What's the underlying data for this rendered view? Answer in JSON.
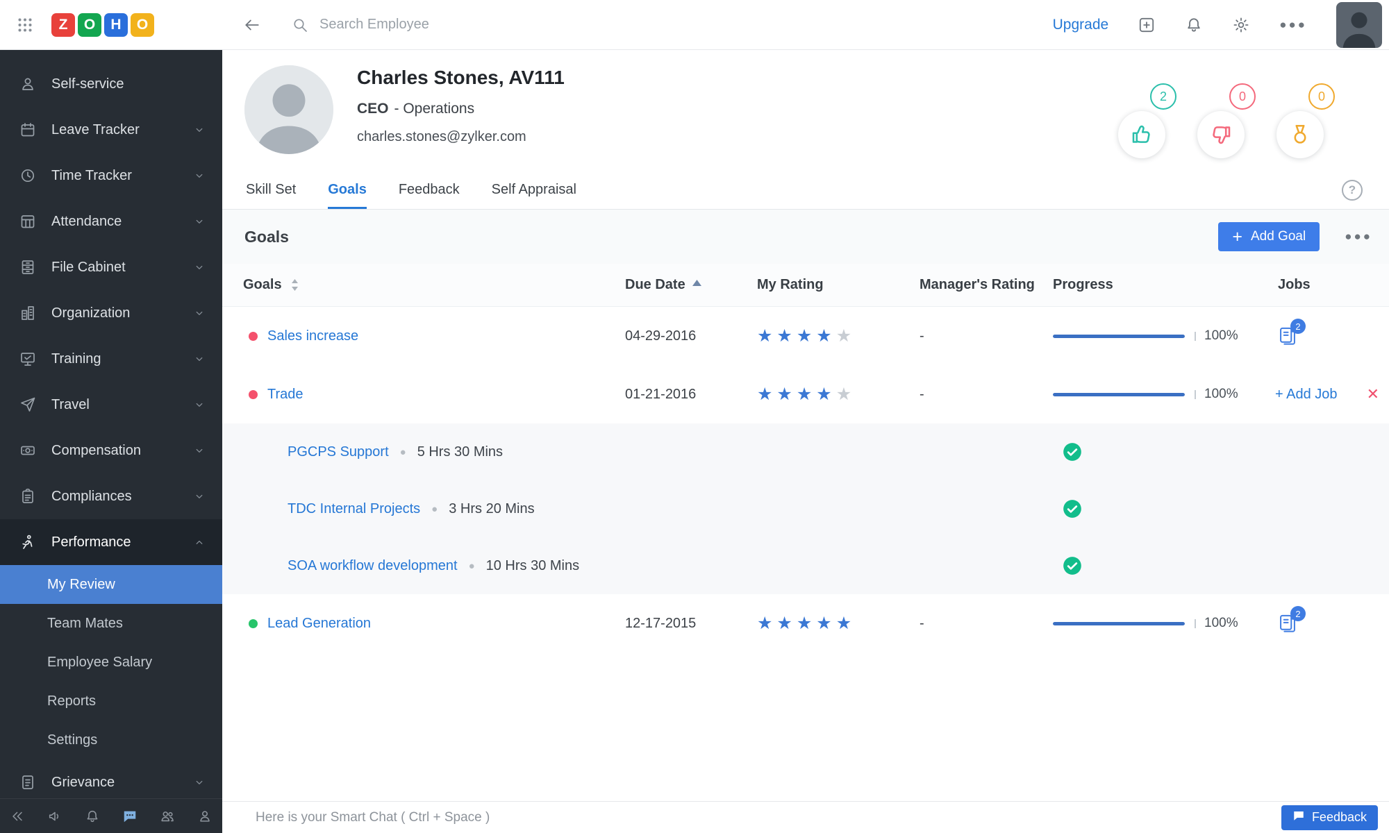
{
  "topbar": {
    "logo_letters": [
      "Z",
      "O",
      "H",
      "O"
    ],
    "logo_colors": [
      "#e8413b",
      "#13a650",
      "#2a6fdb",
      "#f2b21c"
    ],
    "search_placeholder": "Search Employee",
    "upgrade_label": "Upgrade"
  },
  "sidebar": {
    "items": [
      {
        "label": "Self-service",
        "icon": "user-icon",
        "chevron": false
      },
      {
        "label": "Leave Tracker",
        "icon": "calendar-icon",
        "chevron": true
      },
      {
        "label": "Time Tracker",
        "icon": "clock-icon",
        "chevron": true
      },
      {
        "label": "Attendance",
        "icon": "calendar-grid-icon",
        "chevron": true
      },
      {
        "label": "File Cabinet",
        "icon": "cabinet-icon",
        "chevron": true
      },
      {
        "label": "Organization",
        "icon": "building-icon",
        "chevron": true
      },
      {
        "label": "Training",
        "icon": "presentation-icon",
        "chevron": true
      },
      {
        "label": "Travel",
        "icon": "plane-icon",
        "chevron": true
      },
      {
        "label": "Compensation",
        "icon": "banknote-icon",
        "chevron": true
      },
      {
        "label": "Compliances",
        "icon": "clipboard-icon",
        "chevron": true
      },
      {
        "label": "Performance",
        "icon": "runner-icon",
        "chevron": true,
        "active": true,
        "expanded": true
      },
      {
        "label": "Grievance",
        "icon": "document-icon",
        "chevron": true
      }
    ],
    "performance_subitems": [
      {
        "label": "My Review",
        "selected": true
      },
      {
        "label": "Team Mates",
        "selected": false
      },
      {
        "label": "Employee Salary",
        "selected": false
      },
      {
        "label": "Reports",
        "selected": false
      },
      {
        "label": "Settings",
        "selected": false
      }
    ]
  },
  "profile": {
    "name": "Charles Stones, AV111",
    "role": "CEO",
    "role_rest": "- Operations",
    "email": "charles.stones@zylker.com",
    "badges": [
      {
        "name": "thumbs-up",
        "count": "2",
        "color": "#2bbfab"
      },
      {
        "name": "thumbs-down",
        "count": "0",
        "color": "#f4697c"
      },
      {
        "name": "medal",
        "count": "0",
        "color": "#f0a92e"
      }
    ]
  },
  "tabs": [
    {
      "label": "Skill Set",
      "active": false
    },
    {
      "label": "Goals",
      "active": true
    },
    {
      "label": "Feedback",
      "active": false
    },
    {
      "label": "Self Appraisal",
      "active": false
    }
  ],
  "goals": {
    "title": "Goals",
    "add_button_label": "Add Goal",
    "columns": [
      "Goals",
      "Due Date",
      "My Rating",
      "Manager's Rating",
      "Progress",
      "Jobs"
    ],
    "rows": [
      {
        "name": "Sales increase",
        "status_color": "#f4516c",
        "due": "04-29-2016",
        "my_rating": 4,
        "manager_rating": "-",
        "progress": 100,
        "progress_label": "100%",
        "jobs_count": "2",
        "jobs": []
      },
      {
        "name": "Trade",
        "status_color": "#f4516c",
        "due": "01-21-2016",
        "my_rating": 4,
        "manager_rating": "-",
        "progress": 100,
        "progress_label": "100%",
        "add_job_label": "+ Add Job",
        "closable": true,
        "jobs": [
          {
            "name": "PGCPS Support",
            "duration": "5 Hrs 30 Mins",
            "done": true
          },
          {
            "name": "TDC Internal Projects",
            "duration": "3 Hrs 20 Mins",
            "done": true
          },
          {
            "name": "SOA workflow development",
            "duration": "10 Hrs 30 Mins",
            "done": true
          }
        ]
      },
      {
        "name": "Lead Generation",
        "status_color": "#27c46a",
        "due": "12-17-2015",
        "my_rating": 5,
        "manager_rating": "-",
        "progress": 100,
        "progress_label": "100%",
        "jobs_count": "2",
        "jobs": []
      }
    ]
  },
  "chatbar": {
    "placeholder": "Here is your Smart Chat ( Ctrl + Space )",
    "feedback_label": "Feedback"
  },
  "colors": {
    "accent_blue": "#2679d6",
    "button_blue": "#3e7de9",
    "star_filled": "#3b78d4",
    "star_empty": "#c8cdd3",
    "check_green": "#12bd8b",
    "sidebar_dark": "#272d34",
    "selected_nav_blue": "#4a80d1"
  }
}
